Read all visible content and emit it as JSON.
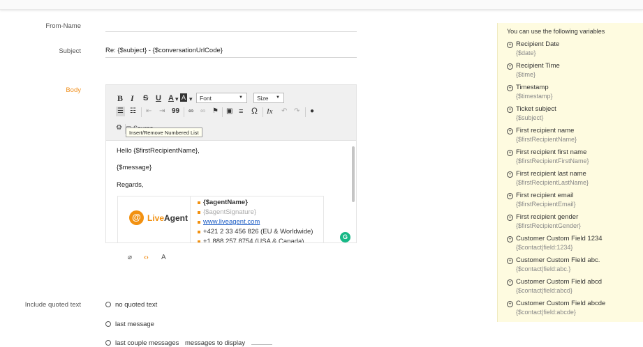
{
  "labels": {
    "from_name": "From-Name",
    "subject": "Subject",
    "body": "Body",
    "include_quoted": "Include quoted text"
  },
  "fields": {
    "from_name_value": "",
    "subject_value": "Re: {$subject} - {$conversationUrlCode}"
  },
  "toolbar": {
    "bold": "B",
    "italic": "I",
    "strike": "S",
    "underline": "U",
    "text_color": "A",
    "bg_color": "A",
    "font": "Font",
    "size": "Size",
    "blockquote": "99",
    "special_char": "Ω",
    "clear_format": "Ix",
    "source": "Source",
    "tooltip": "Insert/Remove Numbered List"
  },
  "editor": {
    "line1": "Hello {$firstRecipientName},",
    "line2": "{$message}",
    "line3": "Regards,",
    "logo_live": "Live",
    "logo_agent": "Agent",
    "sig_agent_name": "{$agentName}",
    "sig_agent_signature": "{$agentSignature}",
    "sig_url": "www.liveagent.com",
    "sig_phone1": "+421 2 33 456 826 (EU & Worldwide)",
    "sig_phone2": "+1 888 257 8754 (USA & Canada)"
  },
  "bottom_bar": {
    "text_label": "A"
  },
  "quoted_options": [
    "no quoted text",
    "last message",
    "last couple messages"
  ],
  "messages_to_display_label": "messages to display",
  "variables_panel": {
    "title": "You can use the following variables",
    "items": [
      {
        "name": "Recipient Date",
        "code": "{$date}"
      },
      {
        "name": "Recipient Time",
        "code": "{$time}"
      },
      {
        "name": "Timestamp",
        "code": "{$timestamp}"
      },
      {
        "name": "Ticket subject",
        "code": "{$subject}"
      },
      {
        "name": "First recipient name",
        "code": "{$firstRecipientName}"
      },
      {
        "name": "First recipient first name",
        "code": "{$firstRecipientFirstName}"
      },
      {
        "name": "First recipient last name",
        "code": "{$firstRecipientLastName}"
      },
      {
        "name": "First recipient email",
        "code": "{$firstRecipientEmail}"
      },
      {
        "name": "First recipient gender",
        "code": "{$firstRecipientGender}"
      },
      {
        "name": "Customer Custom Field 1234",
        "code": "{$contact|field:1234}"
      },
      {
        "name": "Customer Custom Field abc.",
        "code": "{$contact|field:abc.}"
      },
      {
        "name": "Customer Custom Field abcd",
        "code": "{$contact|field:abcd}"
      },
      {
        "name": "Customer Custom Field abcde",
        "code": "{$contact|field:abcde}"
      }
    ]
  },
  "colors": {
    "accent_orange": "#f0901e",
    "panel_bg": "#fefbe0",
    "grammarly_green": "#17b886",
    "link_blue": "#1a5bc4"
  }
}
